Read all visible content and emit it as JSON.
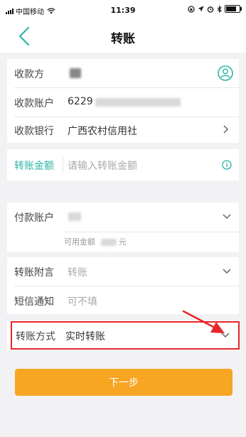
{
  "status_bar": {
    "carrier": "中国移动",
    "time": "11:39"
  },
  "nav": {
    "title": "转账"
  },
  "payee_section": {
    "payee_label": "收款方",
    "account_label": "收款账户",
    "account_value": "6229",
    "bank_label": "收款银行",
    "bank_value": "广西农村信用社"
  },
  "amount_section": {
    "amount_label": "转账金额",
    "amount_placeholder": "请输入转账金额"
  },
  "payer_section": {
    "payer_label": "付款账户",
    "available_label": "可用金额",
    "available_suffix": "元"
  },
  "note_section": {
    "note_label": "转账附言",
    "note_placeholder": "转账",
    "sms_label": "短信通知",
    "sms_placeholder": "可不填"
  },
  "method_section": {
    "method_label": "转账方式",
    "method_value": "实时转账"
  },
  "next_button": {
    "label": "下一步"
  },
  "colors": {
    "accent": "#2bb5a6",
    "button": "#f6a623",
    "highlight": "#e8252b"
  }
}
